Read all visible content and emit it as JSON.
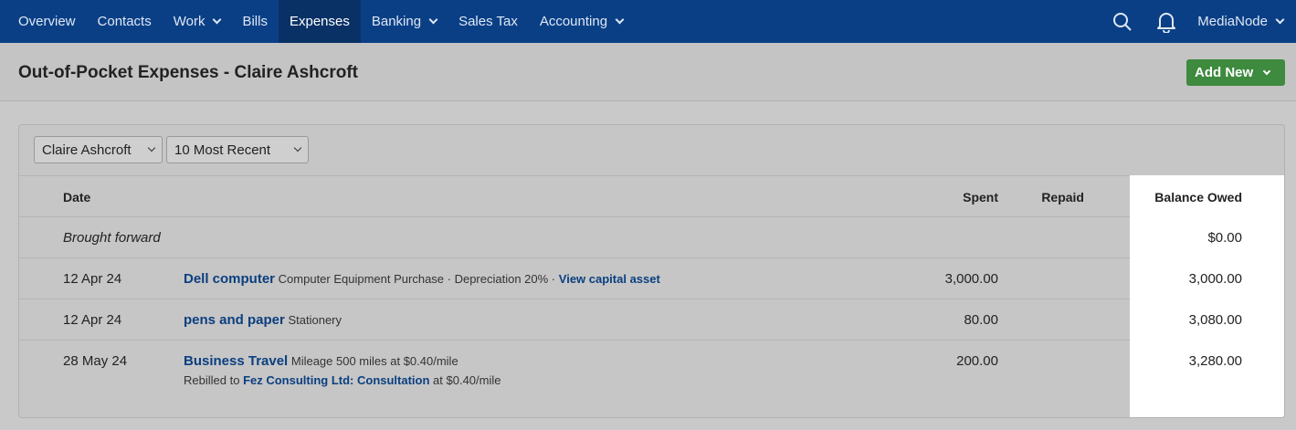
{
  "nav": {
    "items": [
      {
        "label": "Overview",
        "dropdown": false,
        "active": false
      },
      {
        "label": "Contacts",
        "dropdown": false,
        "active": false
      },
      {
        "label": "Work",
        "dropdown": true,
        "active": false
      },
      {
        "label": "Bills",
        "dropdown": false,
        "active": false
      },
      {
        "label": "Expenses",
        "dropdown": false,
        "active": true
      },
      {
        "label": "Banking",
        "dropdown": true,
        "active": false
      },
      {
        "label": "Sales Tax",
        "dropdown": false,
        "active": false
      },
      {
        "label": "Accounting",
        "dropdown": true,
        "active": false
      }
    ],
    "org_name": "MediaNode",
    "icons": [
      "search-icon",
      "bell-icon"
    ]
  },
  "page": {
    "title": "Out-of-Pocket Expenses - Claire Ashcroft",
    "add_new_label": "Add New"
  },
  "filters": {
    "person": "Claire Ashcroft",
    "range": "10 Most Recent"
  },
  "table": {
    "headers": {
      "date": "Date",
      "spent": "Spent",
      "repaid": "Repaid",
      "balance": "Balance Owed"
    },
    "brought_forward": {
      "label": "Brought forward",
      "balance": "$0.00"
    },
    "rows": [
      {
        "date": "12 Apr 24",
        "title": "Dell computer",
        "detail": "Computer Equipment Purchase · Depreciation 20% ·",
        "extra_link": "View capital asset",
        "spent": "3,000.00",
        "repaid": "",
        "balance": "3,000.00"
      },
      {
        "date": "12 Apr 24",
        "title": "pens and paper",
        "detail": "Stationery",
        "spent": "80.00",
        "repaid": "",
        "balance": "3,080.00"
      },
      {
        "date": "28 May 24",
        "title": "Business Travel",
        "detail": "Mileage 500 miles at $0.40/mile",
        "rebill_prefix": "Rebilled to",
        "rebill_link": "Fez Consulting Ltd: Consultation",
        "rebill_suffix": "at $0.40/mile",
        "spent": "200.00",
        "repaid": "",
        "balance": "3,280.00"
      }
    ]
  }
}
